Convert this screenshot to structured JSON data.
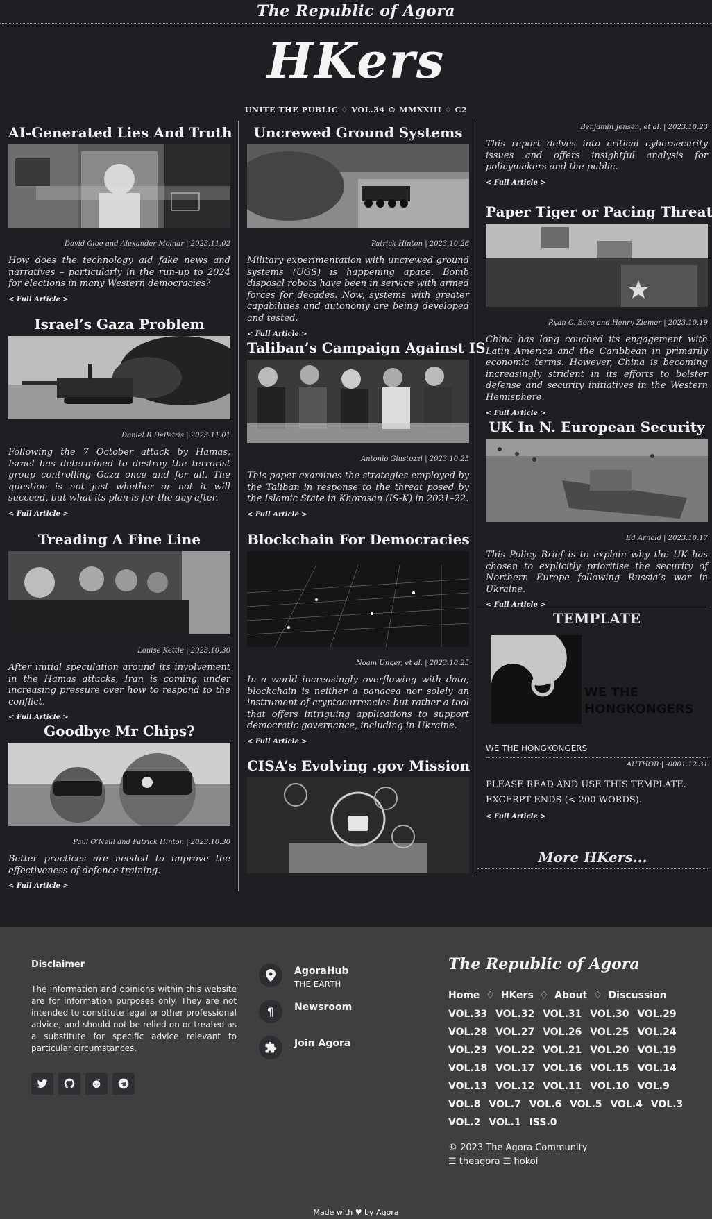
{
  "header": {
    "site_title": "The Republic of Agora",
    "logo": "HKers",
    "tagline": "UNITE THE PUBLIC ♢ VOL.34 © MMXXIII ♢ C2"
  },
  "full_article_label": "< Full Article >",
  "columns": {
    "col1": [
      {
        "title": "AI-Generated Lies And Truth",
        "byline": "David Gioe and Alexander Molnar | 2023.11.02",
        "summary": "How does the technology aid fake news and narratives – particularly in the run-up to 2024 for elections in many Western democracies?"
      },
      {
        "title": "Israel’s Gaza Problem",
        "byline": "Daniel R DePetris | 2023.11.01",
        "summary": "Following the 7 October attack by Hamas, Israel has determined to destroy the terrorist group controlling Gaza once and for all. The question is not just whether or not it will succeed, but what its plan is for the day after."
      },
      {
        "title": "Treading A Fine Line",
        "byline": "Louise Kettle | 2023.10.30",
        "summary": "After initial speculation around its involvement in the Hamas attacks, Iran is coming under increasing pressure over how to respond to the conflict."
      },
      {
        "title": "Goodbye Mr Chips?",
        "byline": "Paul O’Neill and Patrick Hinton | 2023.10.30",
        "summary": "Better practices are needed to improve the effectiveness of defence training."
      }
    ],
    "col2": [
      {
        "title": "Uncrewed Ground Systems",
        "byline": "Patrick Hinton | 2023.10.26",
        "summary": "Military experimentation with uncrewed ground systems (UGS) is happening apace. Bomb disposal robots have been in service with armed forces for decades. Now, systems with greater capabilities and autonomy are being developed and tested."
      },
      {
        "title": "Taliban’s Campaign Against IS",
        "byline": "Antonio Giustozzi | 2023.10.25",
        "summary": "This paper examines the strategies employed by the Taliban in response to the threat posed by the Islamic State in Khorasan (IS-K) in 2021–22."
      },
      {
        "title": "Blockchain For Democracies",
        "byline": "Noam Unger, et al. | 2023.10.25",
        "summary": "In a world increasingly overflowing with data, blockchain is neither a panacea nor solely an instrument of cryptocurrencies but rather a tool that offers intriguing applications to support democratic governance, including in Ukraine."
      },
      {
        "title": "CISA’s Evolving .gov Mission"
      }
    ],
    "col3_partial": {
      "byline": "Benjamin Jensen, et al. | 2023.10.23",
      "summary": "This report delves into critical cybersecurity issues and offers insightful analysis for policymakers and the public."
    },
    "col3": [
      {
        "title": "Paper Tiger or Pacing Threat?",
        "byline": "Ryan C. Berg and Henry Ziemer | 2023.10.19",
        "summary": "China has long couched its engagement with Latin America and the Caribbean in primarily economic terms. However, China is becoming increasingly strident in its efforts to bolster defense and security initiatives in the Western Hemisphere."
      },
      {
        "title": "UK In N. European Security",
        "byline": "Ed Arnold | 2023.10.17",
        "summary": "This Policy Brief is to explain why the UK has chosen to explicitly prioritise the security of Northern Europe following Russia’s war in Ukraine."
      }
    ],
    "template": {
      "title": "TEMPLATE",
      "image_text_1": "WE THE",
      "image_text_2": "HONGKONGERS",
      "caption": "WE THE HONGKONGERS",
      "byline": "AUTHOR | -0001.12.31",
      "body_1": "PLEASE READ AND USE THIS TEMPLATE.",
      "body_2": "EXCERPT ENDS (< 200 WORDS)."
    },
    "more": "More HKers..."
  },
  "footer": {
    "disclaimer_title": "Disclaimer",
    "disclaimer_text": "The information and opinions within this website are for information purposes only. They are not intended to constitute legal or other professional advice, and should not be relied on or treated as a substitute for specific advice relevant to particular circumstances.",
    "social_icons": [
      "twitter-icon",
      "github-icon",
      "reddit-icon",
      "telegram-icon"
    ],
    "hub_title": "AgoraHub",
    "hub_sub": "THE EARTH",
    "newsroom": "Newsroom",
    "join": "Join Agora",
    "brand": "The Republic of Agora",
    "nav": [
      "Home",
      "HKers",
      "About",
      "Discussion"
    ],
    "nav_sep": "♢",
    "vols": [
      "VOL.33",
      "VOL.32",
      "VOL.31",
      "VOL.30",
      "VOL.29",
      "VOL.28",
      "VOL.27",
      "VOL.26",
      "VOL.25",
      "VOL.24",
      "VOL.23",
      "VOL.22",
      "VOL.21",
      "VOL.20",
      "VOL.19",
      "VOL.18",
      "VOL.17",
      "VOL.16",
      "VOL.15",
      "VOL.14",
      "VOL.13",
      "VOL.12",
      "VOL.11",
      "VOL.10",
      "VOL.9",
      "VOL.8",
      "VOL.7",
      "VOL.6",
      "VOL.5",
      "VOL.4",
      "VOL.3",
      "VOL.2",
      "VOL.1",
      "ISS.0"
    ],
    "copyright": "© 2023 The Agora Community",
    "links": "☰ theagora ☰ hokoi",
    "made_with": "Made with ♥ by Agora"
  },
  "colors": {
    "background": "#1e1f23",
    "footer": "#3f3f3f",
    "text": "#e6e6e6",
    "rule": "#9a9a9a"
  }
}
